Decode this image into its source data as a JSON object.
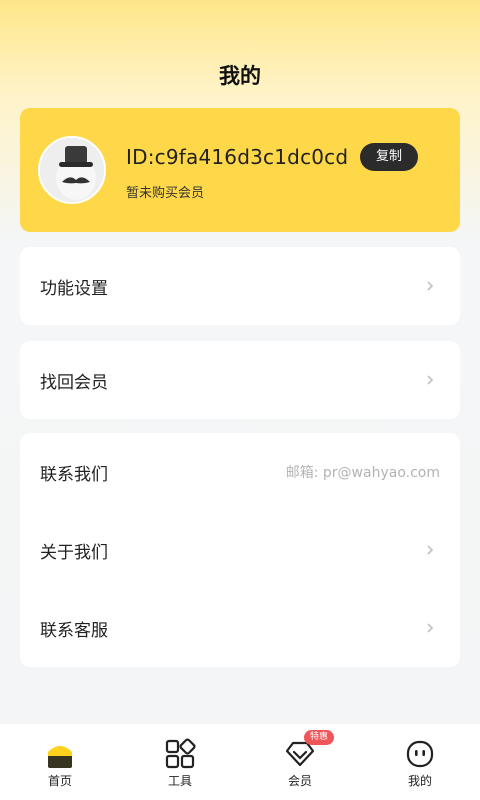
{
  "header": {
    "title": "我的"
  },
  "profile": {
    "id_text": "ID:c9fa416d3c1dc0cd",
    "copy_label": "复制",
    "member_status": "暂未购买会员",
    "avatar_icon": "mustache-hat-avatar-icon"
  },
  "menu": {
    "function_settings": "功能设置",
    "recover_membership": "找回会员",
    "contact_us": "联系我们",
    "contact_email": "邮箱: pr@wahyao.com",
    "about_us": "关于我们",
    "customer_service": "联系客服"
  },
  "tabbar": {
    "items": [
      {
        "label": "首页",
        "icon": "home-icon",
        "active": true
      },
      {
        "label": "工具",
        "icon": "grid-icon",
        "active": false
      },
      {
        "label": "会员",
        "icon": "vip-diamond-icon",
        "active": false,
        "badge": "特惠"
      },
      {
        "label": "我的",
        "icon": "face-icon",
        "active": false
      }
    ]
  },
  "colors": {
    "accent": "#ffd84a",
    "badge": "#f0555a",
    "dark": "#2b2b2b"
  }
}
